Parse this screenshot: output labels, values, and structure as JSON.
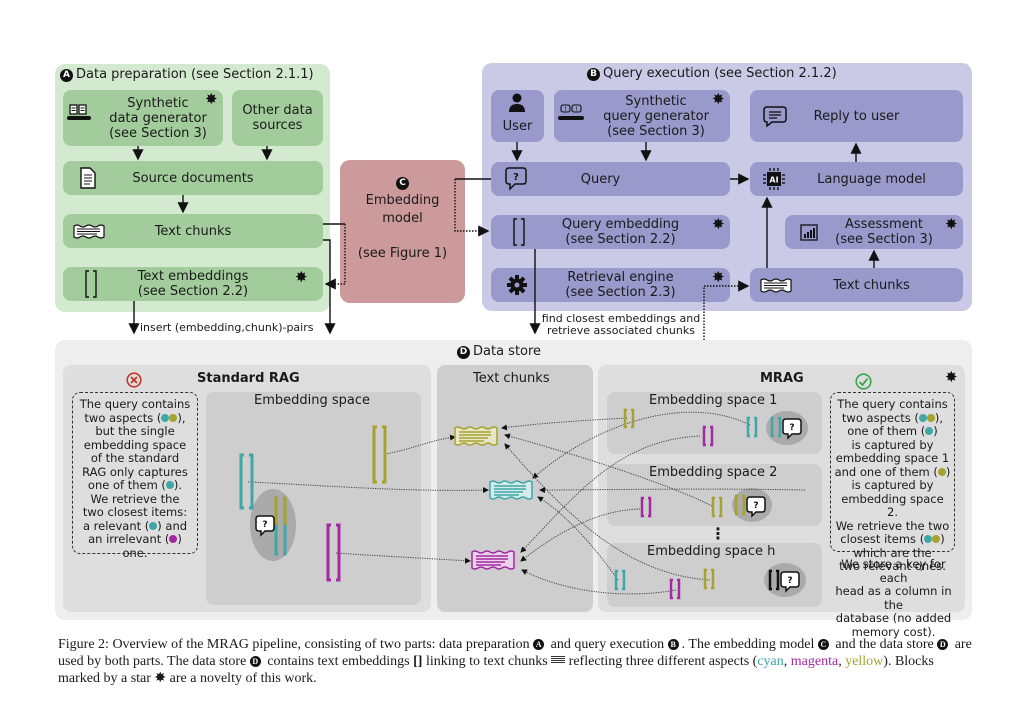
{
  "colors": {
    "data_prep_bg": "#d4ead0",
    "data_prep_box": "#a3cc9c",
    "query_exec_bg": "#cac9e6",
    "query_exec_box": "#9a99cc",
    "embedding_model": "#cc9a9a",
    "data_store_bg": "#eeeeee",
    "cyan": "#3fa7a8",
    "magenta": "#a12aa3",
    "yellow": "#a6a22e",
    "fail_red": "#c0392b",
    "success_green": "#3aa64a"
  },
  "data_preparation": {
    "badge": "A",
    "title": "Data preparation (see Section 2.1.1)",
    "synthetic_generator": {
      "line1": "Synthetic",
      "line2": "data generator",
      "line3": "(see Section 3)",
      "icon": "conveyor-documents-icon",
      "novel": true
    },
    "other_sources": {
      "line1": "Other data",
      "line2": "sources"
    },
    "source_documents": {
      "label": "Source documents",
      "icon": "document-icon"
    },
    "text_chunks": {
      "label": "Text chunks",
      "icon": "text-chunk-icon"
    },
    "text_embeddings": {
      "line1": "Text embeddings",
      "line2": "(see Section 2.2)",
      "icon": "embedding-bracket-icon",
      "novel": true
    }
  },
  "embedding_model": {
    "badge": "C",
    "line1": "Embedding",
    "line2": "model",
    "line3": "(see Figure 1)"
  },
  "query_execution": {
    "badge": "B",
    "title": "Query execution (see Section 2.1.2)",
    "user": {
      "label": "User",
      "icon": "user-icon"
    },
    "synthetic_query_generator": {
      "line1": "Synthetic",
      "line2": "query generator",
      "line3": "(see Section 3)",
      "icon": "conveyor-questions-icon",
      "novel": true
    },
    "reply": {
      "label": "Reply to user",
      "icon": "chat-reply-icon"
    },
    "query": {
      "label": "Query",
      "icon": "question-bubble-icon"
    },
    "language_model": {
      "label": "Language model",
      "icon": "ai-chip-icon",
      "chip_text": "AI"
    },
    "query_embedding": {
      "line1": "Query embedding",
      "line2": "(see Section 2.2)",
      "icon": "embedding-bracket-icon",
      "novel": true
    },
    "assessment": {
      "line1": "Assessment",
      "line2": "(see Section 3)",
      "icon": "bar-chart-icon",
      "novel": true
    },
    "retrieval_engine": {
      "line1": "Retrieval engine",
      "line2": "(see Section 2.3)",
      "icon": "gear-icon",
      "novel": true
    },
    "text_chunks": {
      "label": "Text chunks",
      "icon": "text-chunk-icon"
    }
  },
  "edge_labels": {
    "insert": "insert (embedding,chunk)-pairs",
    "find_line1": "find closest embeddings and",
    "find_line2": "retrieve associated chunks"
  },
  "data_store": {
    "badge": "D",
    "title": "Data store",
    "standard_rag": {
      "title": "Standard RAG",
      "status_icon": "fail-x-icon",
      "embedding_space_title": "Embedding space",
      "note_lines": [
        "The query contains",
        "two aspects (",
        "), ",
        "but the single",
        "embedding space",
        "of the standard",
        "RAG only captures",
        "one of them (",
        ").",
        "We retrieve the",
        "two closest items:",
        "a relevant (",
        ") and",
        "an irrelevant (",
        ") one."
      ]
    },
    "text_chunks": {
      "title": "Text chunks"
    },
    "mrag": {
      "title": "MRAG",
      "status_icon": "success-check-icon",
      "novel": true,
      "spaces": [
        "Embedding space 1",
        "Embedding space 2",
        "Embedding space h"
      ],
      "ellipsis": "⋮",
      "note_lines": [
        "The query contains",
        "two aspects (",
        "),",
        "one of them (",
        ")",
        "is captured by",
        "embedding space 1",
        "and one of them (",
        ")",
        "is captured by",
        "embedding space 2.",
        "We retrieve the two",
        "closest items (",
        ")",
        "which are the",
        "two relevant ones."
      ],
      "footnote": [
        "We store a key for each",
        "head as a column in the",
        "database (no added",
        "memory cost)."
      ]
    }
  },
  "caption": {
    "p1": "Figure 2: Overview of the MRAG pipeline, consisting of two parts: data preparation ",
    "p2": " and query execution ",
    "p3": ". The embedding model ",
    "p4": " and the data store ",
    "p5": " are used by both parts. The data store ",
    "p6": " contains text embeddings ",
    "p7": " linking to text chunks ",
    "p8": " reflecting three different aspects (",
    "cyan": "cyan",
    "sep": ", ",
    "magenta": "magenta",
    "yellow": "yellow",
    "p9": "). Blocks marked by a star ",
    "p10": " are a novelty of this work.",
    "bracket_glyph": "[]",
    "star_glyph": "✸"
  }
}
